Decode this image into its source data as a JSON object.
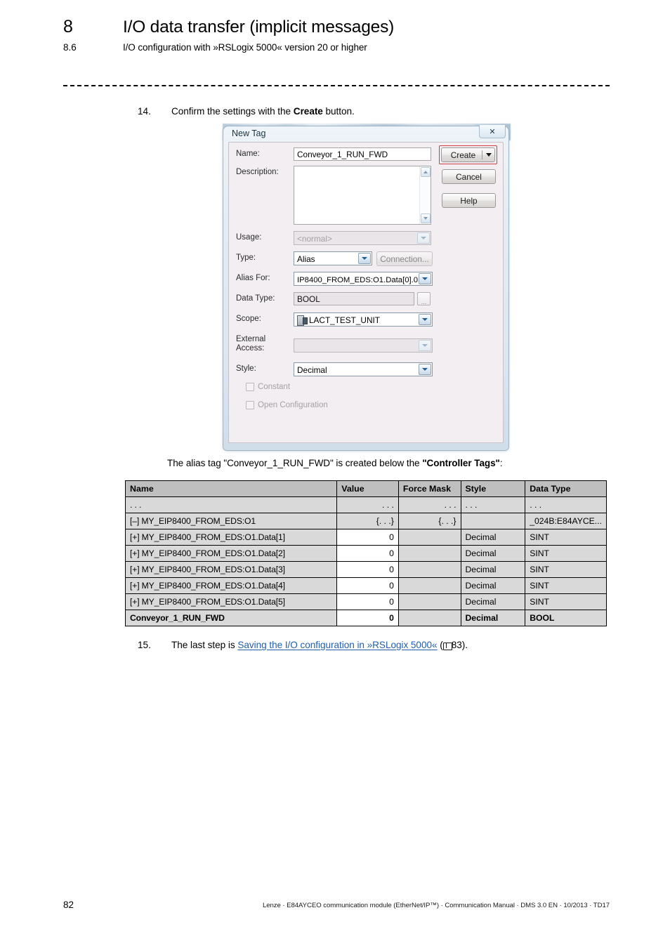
{
  "header": {
    "chapter_number": "8",
    "chapter_title": "I/O data transfer (implicit messages)",
    "section_number": "8.6",
    "section_title": "I/O configuration with »RSLogix 5000« version 20 or higher"
  },
  "steps": {
    "step14": {
      "number": "14.",
      "text_before": "Confirm the settings with the ",
      "bold": "Create",
      "text_after": " button."
    },
    "step15": {
      "number": "15.",
      "text_before": "The last step is ",
      "link": "Saving the I/O configuration in »RSLogix 5000«",
      "ref_open": " (",
      "ref_page": "83",
      "ref_close": ")."
    }
  },
  "dialog": {
    "title": "New Tag",
    "close_label": "✕",
    "fields": {
      "name_label": "Name:",
      "name_value": "Conveyor_1_RUN_FWD",
      "description_label": "Description:",
      "description_value": "",
      "usage_label": "Usage:",
      "usage_value": "<normal>",
      "type_label": "Type:",
      "type_value": "Alias",
      "connection_label": "Connection...",
      "alias_for_label": "Alias For:",
      "alias_for_value": "IP8400_FROM_EDS:O1.Data[0].0",
      "data_type_label": "Data Type:",
      "data_type_value": "BOOL",
      "data_type_browse": "...",
      "scope_label": "Scope:",
      "scope_value": "LACT_TEST_UNIT",
      "external_access_label_line1": "External",
      "external_access_label_line2": "Access:",
      "external_access_value": "",
      "style_label": "Style:",
      "style_value": "Decimal",
      "constant_label": "Constant",
      "open_config_label": "Open Configuration"
    },
    "buttons": {
      "create": "Create",
      "cancel": "Cancel",
      "help": "Help"
    },
    "highlight_color": "#d1403f"
  },
  "caption": {
    "text_before": "The alias tag \"Conveyor_1_RUN_FWD\" is created below the ",
    "bold": "\"Controller Tags\"",
    "text_after": ":"
  },
  "table": {
    "headers": [
      "Name",
      "Value",
      "Force Mask",
      "Style",
      "Data Type"
    ],
    "rows": [
      {
        "name": ". . .",
        "value": ". . .",
        "force_mask": ". . .",
        "style": ". . .",
        "data_type": ". . .",
        "indent": false,
        "bold": false,
        "value_white": false
      },
      {
        "name": "[–] MY_EIP8400_FROM_EDS:O1",
        "value": "{. . .}",
        "force_mask": "{. . .}",
        "style": "",
        "data_type": "_024B:E84AYCE...",
        "indent": false,
        "bold": false,
        "value_white": false
      },
      {
        "name": "[+] MY_EIP8400_FROM_EDS:O1.Data[1]",
        "value": "0",
        "force_mask": "",
        "style": "Decimal",
        "data_type": "SINT",
        "indent": true,
        "bold": false,
        "value_white": true
      },
      {
        "name": "[+] MY_EIP8400_FROM_EDS:O1.Data[2]",
        "value": "0",
        "force_mask": "",
        "style": "Decimal",
        "data_type": "SINT",
        "indent": true,
        "bold": false,
        "value_white": true
      },
      {
        "name": "[+] MY_EIP8400_FROM_EDS:O1.Data[3]",
        "value": "0",
        "force_mask": "",
        "style": "Decimal",
        "data_type": "SINT",
        "indent": true,
        "bold": false,
        "value_white": true
      },
      {
        "name": "[+] MY_EIP8400_FROM_EDS:O1.Data[4]",
        "value": "0",
        "force_mask": "",
        "style": "Decimal",
        "data_type": "SINT",
        "indent": true,
        "bold": false,
        "value_white": true
      },
      {
        "name": "[+] MY_EIP8400_FROM_EDS:O1.Data[5]",
        "value": "0",
        "force_mask": "",
        "style": "Decimal",
        "data_type": "SINT",
        "indent": true,
        "bold": false,
        "value_white": true
      },
      {
        "name": "Conveyor_1_RUN_FWD",
        "value": "0",
        "force_mask": "",
        "style": "Decimal",
        "data_type": "BOOL",
        "indent": false,
        "bold": true,
        "value_white": true
      }
    ]
  },
  "footer": {
    "page_number": "82",
    "text": "Lenze · E84AYCEO communication module (EtherNet/IP™) · Communication Manual · DMS 3.0 EN · 10/2013 · TD17"
  }
}
